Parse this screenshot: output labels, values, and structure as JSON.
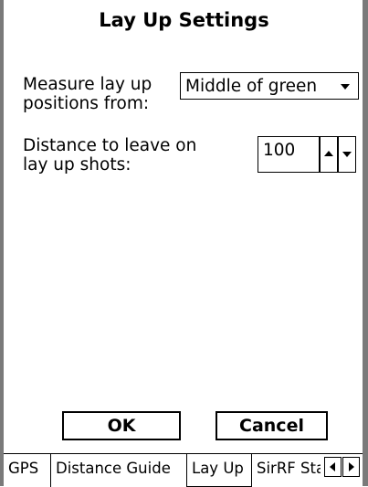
{
  "title": "Lay Up Settings",
  "measure": {
    "label_line1": "Measure lay up",
    "label_line2": "positions from:",
    "selected": "Middle of green"
  },
  "distance": {
    "label_line1": "Distance to leave on",
    "label_line2": "lay up shots:",
    "value": "100"
  },
  "buttons": {
    "ok": "OK",
    "cancel": "Cancel"
  },
  "tabs": [
    {
      "label": "GPS"
    },
    {
      "label": "Distance Guide"
    },
    {
      "label": "Lay Up",
      "active": true
    },
    {
      "label": "SirRF Sta"
    }
  ]
}
